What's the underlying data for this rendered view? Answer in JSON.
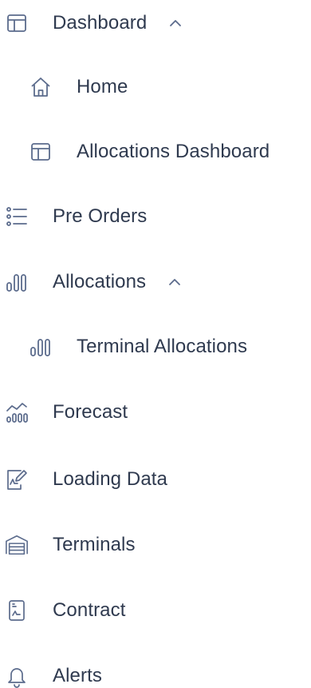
{
  "colors": {
    "icon_stroke": "#5b6b8c",
    "text": "#2f3a4f",
    "background": "#ffffff"
  },
  "sidebar": {
    "items": [
      {
        "label": "Dashboard",
        "icon": "dashboard-icon",
        "expanded": true
      },
      {
        "label": "Home",
        "icon": "home-icon",
        "child_of": "Dashboard"
      },
      {
        "label": "Allocations Dashboard",
        "icon": "dashboard-icon",
        "child_of": "Dashboard"
      },
      {
        "label": "Pre Orders",
        "icon": "list-icon"
      },
      {
        "label": "Allocations",
        "icon": "bar-chart-icon",
        "expanded": true
      },
      {
        "label": "Terminal Allocations",
        "icon": "bar-chart-icon",
        "child_of": "Allocations"
      },
      {
        "label": "Forecast",
        "icon": "forecast-icon"
      },
      {
        "label": "Loading Data",
        "icon": "document-edit-icon"
      },
      {
        "label": "Terminals",
        "icon": "warehouse-icon"
      },
      {
        "label": "Contract",
        "icon": "contract-icon"
      },
      {
        "label": "Alerts",
        "icon": "bell-icon"
      }
    ]
  }
}
